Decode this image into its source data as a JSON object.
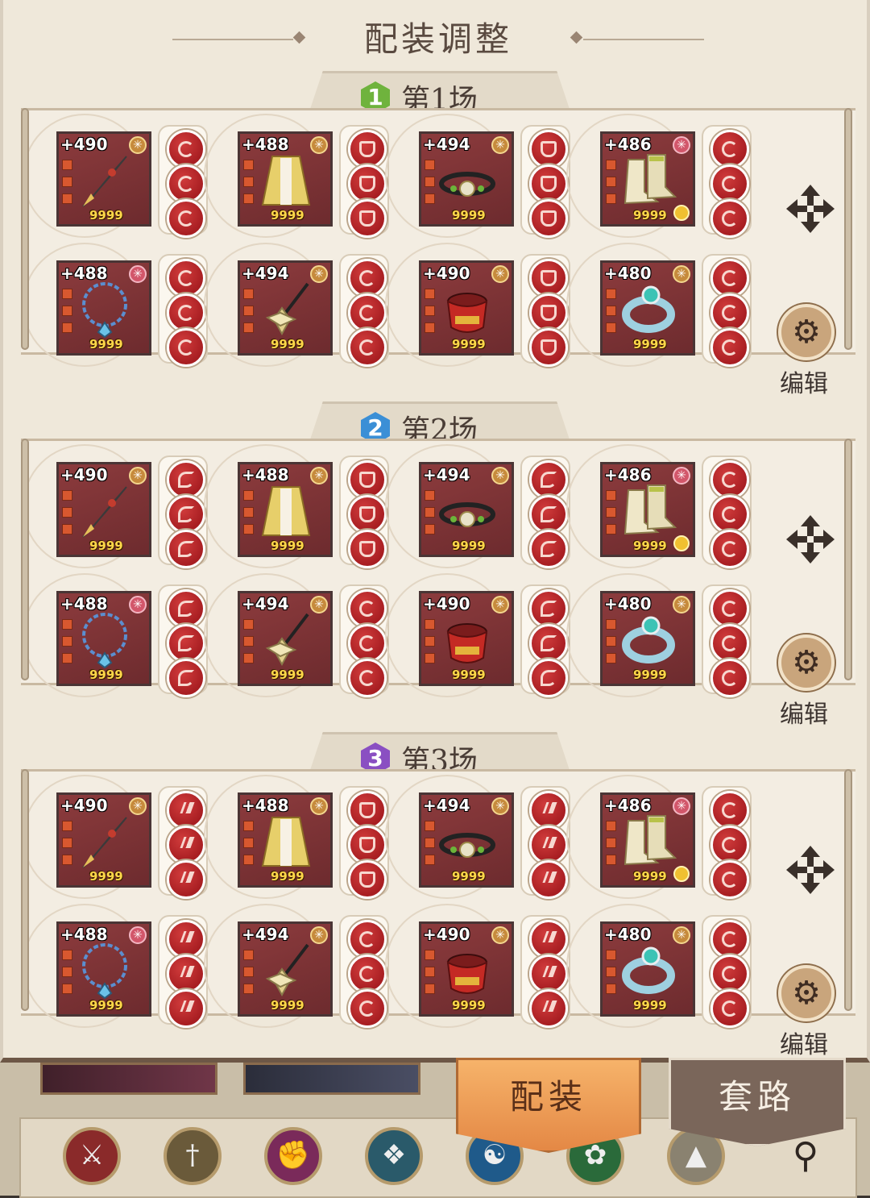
{
  "title": "配装调整",
  "sections": [
    {
      "badge": "1",
      "label": "第1场",
      "badge_color": "#6fb33d",
      "gems": [
        [
          "sickle",
          "sickle",
          "sickle"
        ],
        [
          "shield",
          "shield",
          "shield"
        ],
        [
          "shield",
          "shield",
          "shield"
        ],
        [
          "sickle",
          "sickle",
          "sickle"
        ],
        [
          "sickle",
          "sickle",
          "sickle"
        ],
        [
          "sickle",
          "sickle",
          "sickle"
        ],
        [
          "shield",
          "shield",
          "shield"
        ],
        [
          "sickle",
          "sickle",
          "sickle"
        ]
      ]
    },
    {
      "badge": "2",
      "label": "第2场",
      "badge_color": "#3b8fd6",
      "gems": [
        [
          "flower",
          "flower",
          "flower"
        ],
        [
          "shield",
          "shield",
          "shield"
        ],
        [
          "flower",
          "flower",
          "flower"
        ],
        [
          "sickle",
          "sickle",
          "sickle"
        ],
        [
          "flower",
          "flower",
          "flower"
        ],
        [
          "sickle",
          "sickle",
          "sickle"
        ],
        [
          "flower",
          "flower",
          "flower"
        ],
        [
          "sickle",
          "sickle",
          "sickle"
        ]
      ]
    },
    {
      "badge": "3",
      "label": "第3场",
      "badge_color": "#8a4fc2",
      "gems": [
        [
          "claw",
          "claw",
          "claw"
        ],
        [
          "shield",
          "shield",
          "shield"
        ],
        [
          "claw",
          "claw",
          "claw"
        ],
        [
          "sickle",
          "sickle",
          "sickle"
        ],
        [
          "claw",
          "claw",
          "claw"
        ],
        [
          "sickle",
          "sickle",
          "sickle"
        ],
        [
          "claw",
          "claw",
          "claw"
        ],
        [
          "sickle",
          "sickle",
          "sickle"
        ]
      ]
    }
  ],
  "items": [
    {
      "name": "dagger",
      "level": "+490",
      "durability": "9999",
      "rarity": "gold"
    },
    {
      "name": "robe",
      "level": "+488",
      "durability": "9999",
      "rarity": "gold"
    },
    {
      "name": "belt",
      "level": "+494",
      "durability": "9999",
      "rarity": "gold"
    },
    {
      "name": "boots",
      "level": "+486",
      "durability": "9999",
      "rarity": "pink",
      "linked": true
    },
    {
      "name": "necklace",
      "level": "+488",
      "durability": "9999",
      "rarity": "pink"
    },
    {
      "name": "hairpin",
      "level": "+494",
      "durability": "9999",
      "rarity": "gold"
    },
    {
      "name": "bracer",
      "level": "+490",
      "durability": "9999",
      "rarity": "gold"
    },
    {
      "name": "ring",
      "level": "+480",
      "durability": "9999",
      "rarity": "gold"
    }
  ],
  "edit_label": "编辑",
  "tabs": {
    "active": "配装",
    "idle": "套路"
  },
  "skills": [
    "sword-icon",
    "dagger-icon",
    "fist-icon",
    "fan-icon",
    "yin-yang-icon",
    "dragon-icon",
    "arrow-icon"
  ],
  "colors": {
    "card": "#7a3236",
    "gem": "#b4262b",
    "tab_active": "#eea05a"
  }
}
